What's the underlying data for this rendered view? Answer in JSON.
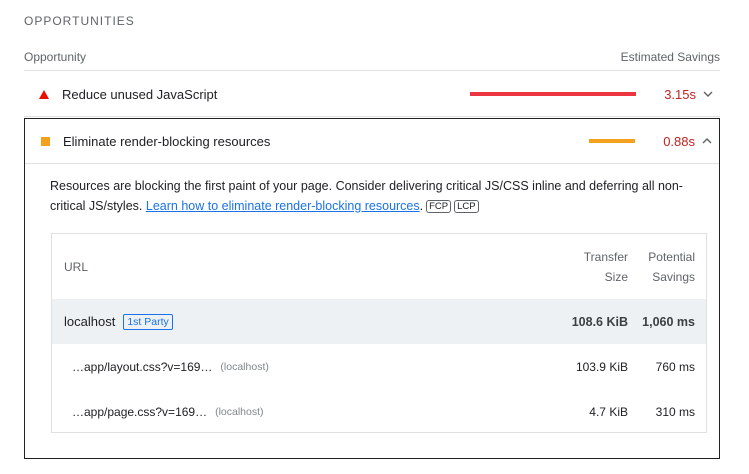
{
  "section": {
    "title": "OPPORTUNITIES"
  },
  "columns": {
    "opportunity": "Opportunity",
    "savings": "Estimated Savings"
  },
  "audits": [
    {
      "title": "Reduce unused JavaScript",
      "savings": "3.15s",
      "bar_fraction": 1.0,
      "bar_color": "#eb3642",
      "icon": "fail-triangle-icon",
      "expanded": false
    },
    {
      "title": "Eliminate render-blocking resources",
      "savings": "0.88s",
      "bar_fraction": 0.28,
      "bar_color": "#f4a11f",
      "icon": "average-square-icon",
      "expanded": true
    }
  ],
  "details": {
    "description": "Resources are blocking the first paint of your page. Consider delivering critical JS/CSS inline and deferring all non-critical JS/styles.",
    "link_text": "Learn how to eliminate render-blocking resources",
    "tags": [
      "FCP",
      "LCP"
    ],
    "table": {
      "headers": {
        "url": "URL",
        "size_line1": "Transfer",
        "size_line2": "Size",
        "savings_line1": "Potential",
        "savings_line2": "Savings"
      },
      "group": {
        "entity": "localhost",
        "badge": "1st Party",
        "size": "108.6 KiB",
        "savings": "1,060 ms"
      },
      "rows": [
        {
          "url": "…app/layout.css?v=169…",
          "host": "(localhost)",
          "size": "103.9 KiB",
          "savings": "760 ms"
        },
        {
          "url": "…app/page.css?v=169…",
          "host": "(localhost)",
          "size": "4.7 KiB",
          "savings": "310 ms"
        }
      ]
    }
  }
}
